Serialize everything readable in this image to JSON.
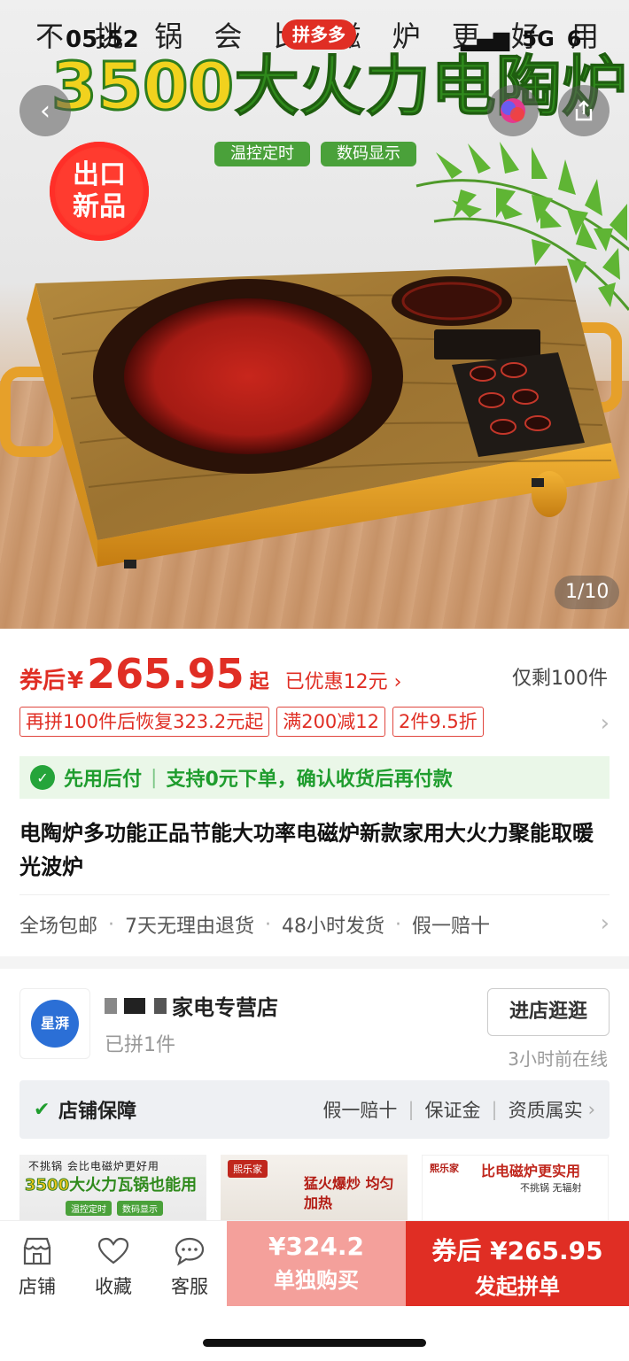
{
  "status_bar": {
    "time": "05:52",
    "signal": "5G",
    "battery": "6"
  },
  "hero": {
    "banner_text": [
      "不",
      "挑",
      "锅",
      "会",
      "比",
      "磁",
      "炉",
      "更",
      "好",
      "用"
    ],
    "title_number": "3500",
    "title_text": "大火力电陶炉",
    "pill_1": "温控定时",
    "pill_2": "数码显示",
    "seal_line_1": "出口",
    "seal_line_2": "新品",
    "app_badge": "拼多多",
    "counter": "1/10"
  },
  "price": {
    "label": "券后",
    "currency": "¥",
    "amount": "265.95",
    "suffix": "起",
    "saved": "已优惠12元",
    "remaining": "仅剩100件"
  },
  "tags": [
    "再拼100件后恢复323.2元起",
    "满200减12",
    "2件9.5折"
  ],
  "pay_later": {
    "title": "先用后付",
    "desc": "支持0元下单，确认收货后再付款"
  },
  "product_title": "电陶炉多功能正品节能大功率电磁炉新款家用大火力聚能取暖光波炉",
  "services": [
    "全场包邮",
    "7天无理由退货",
    "48小时发货",
    "假一赔十"
  ],
  "shop": {
    "logo_text": "星湃",
    "name": "家电专营店",
    "sub": "已拼1件",
    "enter_label": "进店逛逛",
    "online": "3小时前在线",
    "guarantee_title": "店铺保障",
    "guarantee_items": [
      "假一赔十",
      "保证金",
      "资质属实"
    ]
  },
  "thumbs": {
    "t1": {
      "small": "不挑锅 会比电磁炉更好用",
      "num": "3500",
      "big": "大火力瓦锅也能用",
      "pill1": "温控定时",
      "pill2": "数码显示"
    },
    "t2": {
      "brand": "熙乐家",
      "text": "猛火爆炒 均匀加热"
    },
    "t3": {
      "brand": "熙乐家",
      "head": "比电磁炉更实用",
      "sub": "不挑锅 无辐射"
    }
  },
  "bottom_bar": {
    "nav": [
      {
        "label": "店铺",
        "icon": "store-icon"
      },
      {
        "label": "收藏",
        "icon": "heart-icon"
      },
      {
        "label": "客服",
        "icon": "chat-icon"
      }
    ],
    "single_price": "¥324.2",
    "single_label": "单独购买",
    "group_price": "券后 ¥265.95",
    "group_label": "发起拼单"
  },
  "colors": {
    "accent": "#e02e24",
    "green": "#1f9d2e",
    "single_btn": "#f4a09b"
  }
}
